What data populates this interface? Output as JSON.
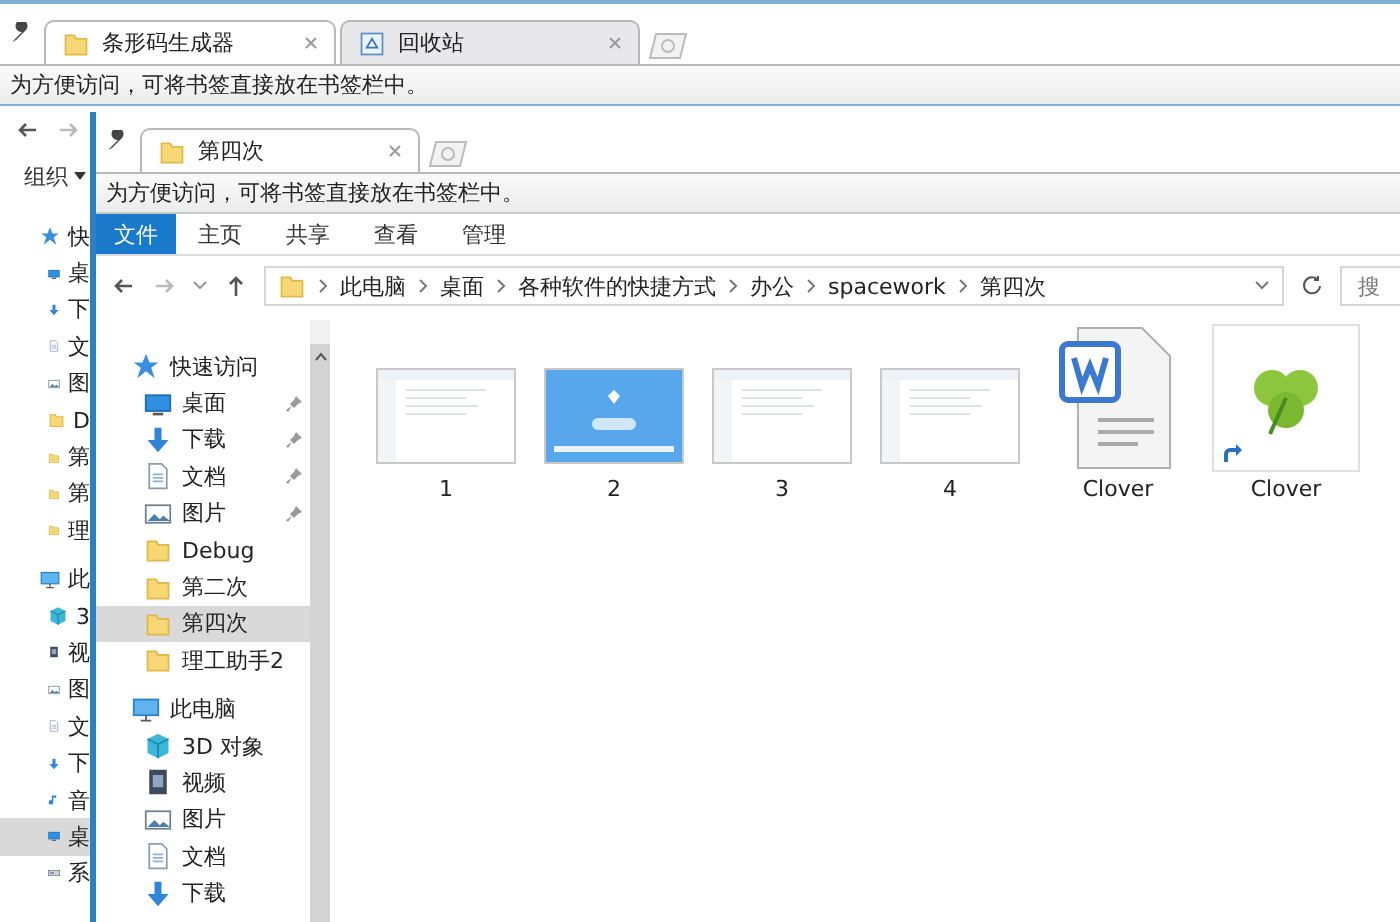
{
  "outer_window": {
    "tabs": [
      {
        "label": "条形码生成器",
        "kind": "folder",
        "selected": true
      },
      {
        "label": "回收站",
        "kind": "recycle",
        "selected": false
      }
    ],
    "bookmark_hint": "为方便访问，可将书签直接放在书签栏中。",
    "organize": "组织",
    "sidebar_items": [
      {
        "label": "快",
        "kind": "star",
        "selected": false
      },
      {
        "label": "桌",
        "kind": "desktop",
        "selected": false
      },
      {
        "label": "下",
        "kind": "download",
        "selected": false
      },
      {
        "label": "文",
        "kind": "document",
        "selected": false
      },
      {
        "label": "图",
        "kind": "picture",
        "selected": false
      },
      {
        "label": "D",
        "kind": "folder",
        "selected": false
      },
      {
        "label": "第",
        "kind": "folder",
        "selected": false
      },
      {
        "label": "第",
        "kind": "folder",
        "selected": false
      },
      {
        "label": "理",
        "kind": "folder",
        "selected": false
      },
      {
        "label": "此",
        "kind": "pc",
        "selected": false
      },
      {
        "label": "3",
        "kind": "cube",
        "selected": false
      },
      {
        "label": "视",
        "kind": "video",
        "selected": false
      },
      {
        "label": "图",
        "kind": "picture",
        "selected": false
      },
      {
        "label": "文",
        "kind": "document",
        "selected": false
      },
      {
        "label": "下",
        "kind": "download",
        "selected": false
      },
      {
        "label": "音",
        "kind": "music",
        "selected": false
      },
      {
        "label": "桌",
        "kind": "desktop",
        "selected": true
      },
      {
        "label": "系",
        "kind": "drive",
        "selected": false
      }
    ]
  },
  "front_window": {
    "tabs": [
      {
        "label": "第四次",
        "kind": "folder",
        "selected": true
      }
    ],
    "bookmark_hint": "为方便访问，可将书签直接放在书签栏中。",
    "ribbon_tabs": [
      {
        "label": "文件",
        "selected": true
      },
      {
        "label": "主页",
        "selected": false
      },
      {
        "label": "共享",
        "selected": false
      },
      {
        "label": "查看",
        "selected": false
      },
      {
        "label": "管理",
        "selected": false
      }
    ],
    "breadcrumb": [
      "此电脑",
      "桌面",
      "各种软件的快捷方式",
      "办公",
      "spacework",
      "第四次"
    ],
    "search_placeholder": "搜",
    "nav_items": [
      {
        "label": "快速访问",
        "kind": "star",
        "selected": false,
        "children": [
          {
            "label": "桌面",
            "kind": "desktop",
            "pinned": true,
            "selected": false
          },
          {
            "label": "下载",
            "kind": "download",
            "pinned": true,
            "selected": false
          },
          {
            "label": "文档",
            "kind": "document",
            "pinned": true,
            "selected": false
          },
          {
            "label": "图片",
            "kind": "picture",
            "pinned": true,
            "selected": false
          },
          {
            "label": "Debug",
            "kind": "folder",
            "pinned": false,
            "selected": false
          },
          {
            "label": "第二次",
            "kind": "folder",
            "pinned": false,
            "selected": false
          },
          {
            "label": "第四次",
            "kind": "folder",
            "pinned": false,
            "selected": true
          },
          {
            "label": "理工助手2",
            "kind": "folder",
            "pinned": false,
            "selected": false
          }
        ]
      },
      {
        "label": "此电脑",
        "kind": "pc",
        "selected": false,
        "children": [
          {
            "label": "3D 对象",
            "kind": "cube",
            "pinned": false,
            "selected": false
          },
          {
            "label": "视频",
            "kind": "video",
            "pinned": false,
            "selected": false
          },
          {
            "label": "图片",
            "kind": "picture",
            "pinned": false,
            "selected": false
          },
          {
            "label": "文档",
            "kind": "document",
            "pinned": false,
            "selected": false
          },
          {
            "label": "下载",
            "kind": "download",
            "pinned": false,
            "selected": false
          }
        ]
      }
    ],
    "files": [
      {
        "name": "1",
        "kind": "screenshot"
      },
      {
        "name": "2",
        "kind": "app-screenshot"
      },
      {
        "name": "3",
        "kind": "screenshot"
      },
      {
        "name": "4",
        "kind": "screenshot"
      },
      {
        "name": "Clover",
        "kind": "word"
      },
      {
        "name": "Clover",
        "kind": "shortcut"
      }
    ]
  }
}
